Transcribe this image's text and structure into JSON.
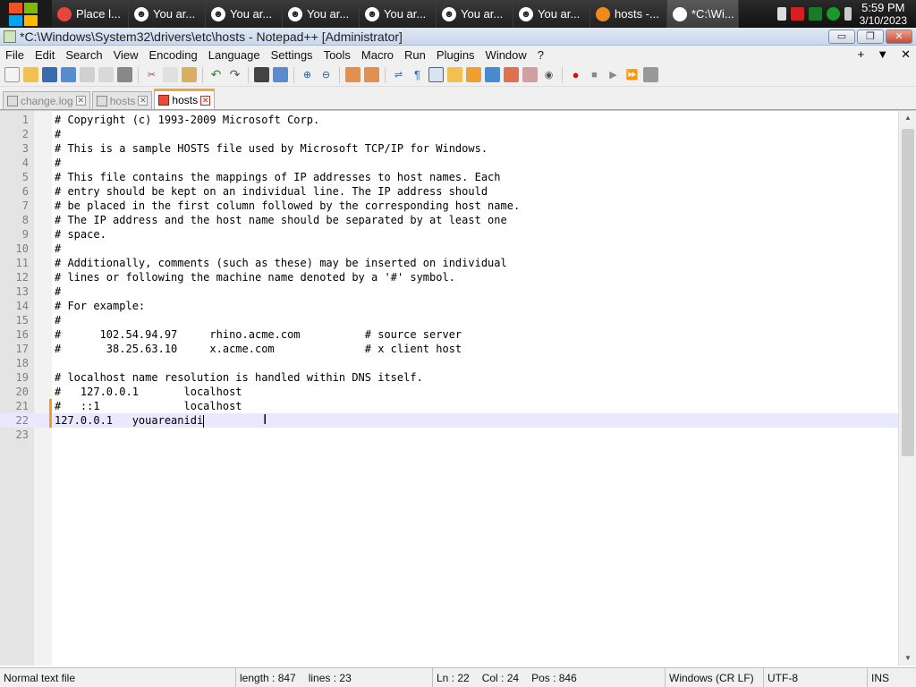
{
  "taskbar": {
    "buttons": [
      {
        "label": "Place l...",
        "icon": "chrome-icon",
        "color": "#e8453c"
      },
      {
        "label": "You ar...",
        "icon": "smiley-icon",
        "color": "#ffffff"
      },
      {
        "label": "You ar...",
        "icon": "smiley-icon",
        "color": "#ffffff"
      },
      {
        "label": "You ar...",
        "icon": "smiley-icon",
        "color": "#ffffff"
      },
      {
        "label": "You ar...",
        "icon": "smiley-icon",
        "color": "#ffffff"
      },
      {
        "label": "You ar...",
        "icon": "smiley-icon",
        "color": "#ffffff"
      },
      {
        "label": "You ar...",
        "icon": "smiley-icon",
        "color": "#ffffff"
      },
      {
        "label": "hosts -...",
        "icon": "search-icon",
        "color": "#f08a1c"
      },
      {
        "label": "*C:\\Wi...",
        "icon": "notepadpp-icon",
        "color": "#ffffff"
      }
    ],
    "clock_time": "5:59 PM",
    "clock_date": "3/10/2023"
  },
  "window": {
    "title": "*C:\\Windows\\System32\\drivers\\etc\\hosts - Notepad++ [Administrator]",
    "min": "▭",
    "max": "❐",
    "close": "✕"
  },
  "menu": {
    "items": [
      "File",
      "Edit",
      "Search",
      "View",
      "Encoding",
      "Language",
      "Settings",
      "Tools",
      "Macro",
      "Run",
      "Plugins",
      "Window",
      "?"
    ],
    "right": [
      "+",
      "▼",
      "✕"
    ]
  },
  "tabs": [
    {
      "label": "change.log",
      "active": false
    },
    {
      "label": "hosts",
      "active": false
    },
    {
      "label": "hosts",
      "active": true
    }
  ],
  "editor": {
    "lines": [
      "# Copyright (c) 1993-2009 Microsoft Corp.",
      "#",
      "# This is a sample HOSTS file used by Microsoft TCP/IP for Windows.",
      "#",
      "# This file contains the mappings of IP addresses to host names. Each",
      "# entry should be kept on an individual line. The IP address should",
      "# be placed in the first column followed by the corresponding host name.",
      "# The IP address and the host name should be separated by at least one",
      "# space.",
      "#",
      "# Additionally, comments (such as these) may be inserted on individual",
      "# lines or following the machine name denoted by a '#' symbol.",
      "#",
      "# For example:",
      "#",
      "#      102.54.94.97     rhino.acme.com          # source server",
      "#       38.25.63.10     x.acme.com              # x client host",
      "",
      "# localhost name resolution is handled within DNS itself.",
      "#   127.0.0.1       localhost",
      "#   ::1             localhost",
      "127.0.0.1   youareanidi",
      ""
    ],
    "current_line": 22,
    "changed_lines": [
      21,
      22
    ]
  },
  "status": {
    "file_type": "Normal text file",
    "length": "length : 847",
    "lines": "lines : 23",
    "ln": "Ln : 22",
    "col": "Col : 24",
    "pos": "Pos : 846",
    "eol": "Windows (CR LF)",
    "encoding": "UTF-8",
    "mode": "INS"
  }
}
